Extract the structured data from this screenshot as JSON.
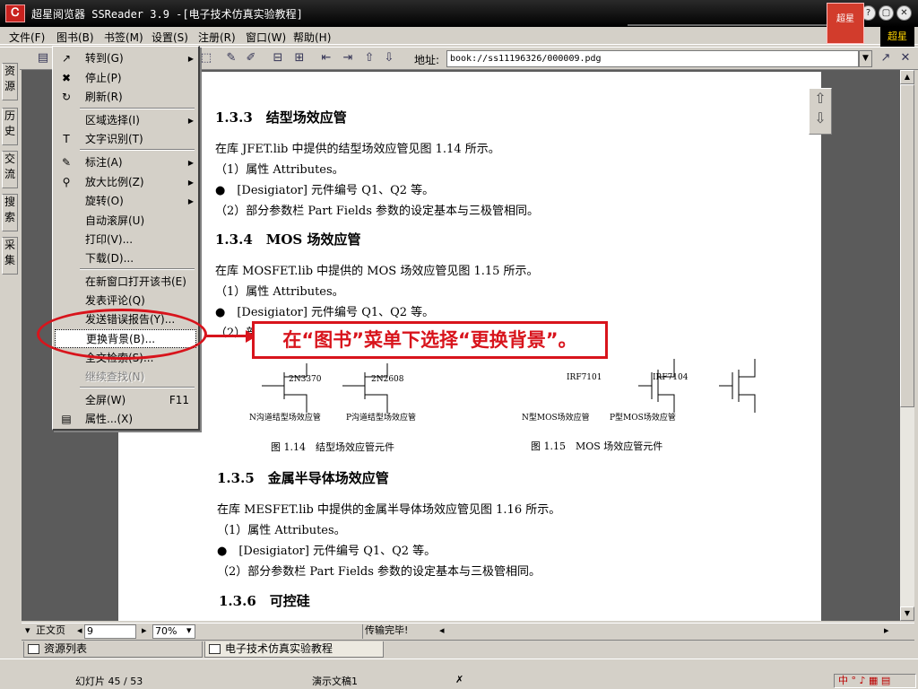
{
  "window": {
    "title": "超星阅览器 SSReader 3.9 -[电子技术仿真实验教程]",
    "brand_badge": "超星"
  },
  "menubar": {
    "items": [
      "文件(F)",
      "图书(B)",
      "书签(M)",
      "设置(S)",
      "注册(R)",
      "窗口(W)",
      "帮助(H)"
    ],
    "globe": "超星"
  },
  "toolbar": {
    "address_label": "地址:",
    "address_value": "book://ss11196326/000009.pdg"
  },
  "sidetabs": [
    "资源",
    "历史",
    "交流",
    "搜索",
    "采集"
  ],
  "book_menu": {
    "items": [
      {
        "label": "转到(G)",
        "icon": "goto-icon",
        "glyph": "↗",
        "submenu": true
      },
      {
        "label": "停止(P)",
        "icon": "stop-icon",
        "glyph": "✖"
      },
      {
        "label": "刷新(R)",
        "icon": "refresh-icon",
        "glyph": "↻"
      },
      {
        "label": "区域选择(I)",
        "submenu": true
      },
      {
        "label": "文字识别(T)",
        "icon": "text-recognize-icon",
        "glyph": "T"
      },
      {
        "label": "标注(A)",
        "icon": "annotate-icon",
        "glyph": "✎",
        "submenu": true
      },
      {
        "label": "放大比例(Z)",
        "icon": "zoom-icon",
        "glyph": "⚲",
        "submenu": true
      },
      {
        "label": "旋转(O)",
        "submenu": true
      },
      {
        "label": "自动滚屏(U)"
      },
      {
        "label": "打印(V)..."
      },
      {
        "label": "下载(D)..."
      },
      {
        "label": "在新窗口打开该书(E)"
      },
      {
        "label": "发表评论(Q)"
      },
      {
        "label": "发送错误报告(Y)..."
      },
      {
        "label": "更换背景(B)...",
        "selected": true
      },
      {
        "label": "全文检索(S)..."
      },
      {
        "label": "继续查找(N)",
        "disabled": true
      },
      {
        "label": "全屏(W)",
        "shortcut": "F11"
      },
      {
        "label": "属性...(X)",
        "icon": "properties-icon",
        "glyph": "▤"
      }
    ]
  },
  "annotation": {
    "callout": "在“图书”菜单下选择“更换背景”。"
  },
  "page": {
    "h133": "1.3.3　结型场效应管",
    "p1": "在库 JFET.lib 中提供的结型场效应管见图 1.14 所示。",
    "p2": "（1）属性 Attributes。",
    "p3": "●　[Desigiator] 元件编号 Q1、Q2 等。",
    "p4": "（2）部分参数栏 Part Fields 参数的设定基本与三极管相同。",
    "h134": "1.3.4　MOS 场效应管",
    "p5": "在库 MOSFET.lib 中提供的 MOS 场效应管见图 1.15 所示。",
    "p6": "（1）属性 Attributes。",
    "p7": "●　[Desigiator] 元件编号 Q1、Q2 等。",
    "p8": "（2）部",
    "fig_labels": [
      "2N3370",
      "2N2608",
      "IRF7101",
      "IRF7104"
    ],
    "fig_names": [
      "N沟道结型场效应管",
      "P沟道结型场效应管",
      "N型MOS场效应管",
      "P型MOS场效应管"
    ],
    "cap114": "图 1.14　结型场效应管元件",
    "cap115": "图 1.15　MOS 场效应管元件",
    "h135": "1.3.5　金属半导体场效应管",
    "p9": "在库 MESFET.lib 中提供的金属半导体场效应管见图 1.16 所示。",
    "p10": "（1）属性 Attributes。",
    "p11": "●　[Desigiator] 元件编号 Q1、Q2 等。",
    "p12": "（2）部分参数栏 Part Fields 参数的设定基本与三极管相同。",
    "h136": "1.3.6　可控硅"
  },
  "statusbar": {
    "mode": "正文页",
    "page": "9",
    "zoom": "70%",
    "message": "传输完毕!"
  },
  "bottomtabs": {
    "resources": "资源列表",
    "book": "电子技术仿真实验教程"
  },
  "taskbar": {
    "slide": "幻灯片 45 / 53",
    "doc": "演示文稿1",
    "lang": "中"
  }
}
